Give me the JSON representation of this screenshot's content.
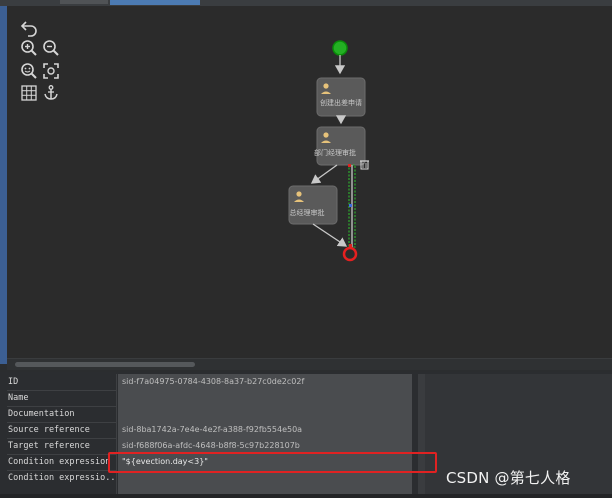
{
  "diagram": {
    "tasks": [
      {
        "label": "创建出差申请"
      },
      {
        "label": "部门经理审批"
      },
      {
        "label": "总经理审批"
      }
    ]
  },
  "colors": {
    "start_event": "#23b023",
    "end_event": "#e62020",
    "task_fill": "#5a5a5a",
    "selected_flow": "#2fb82f",
    "highlight": "#e02222"
  },
  "properties": {
    "rows": [
      {
        "label": "ID",
        "value": "sid-f7a04975-0784-4308-8a37-b27c0de2c02f"
      },
      {
        "label": "Name",
        "value": ""
      },
      {
        "label": "Documentation",
        "value": ""
      },
      {
        "label": "Source reference",
        "value": "sid-8ba1742a-7e4e-4e2f-a388-f92fb554e50a"
      },
      {
        "label": "Target reference",
        "value": "sid-f688f06a-afdc-4648-b8f8-5c97b228107b"
      },
      {
        "label": "Condition expression",
        "value": "\"${evection.day<3}\""
      },
      {
        "label": "Condition expressio...",
        "value": ""
      }
    ]
  },
  "watermark": "CSDN @第七人格"
}
